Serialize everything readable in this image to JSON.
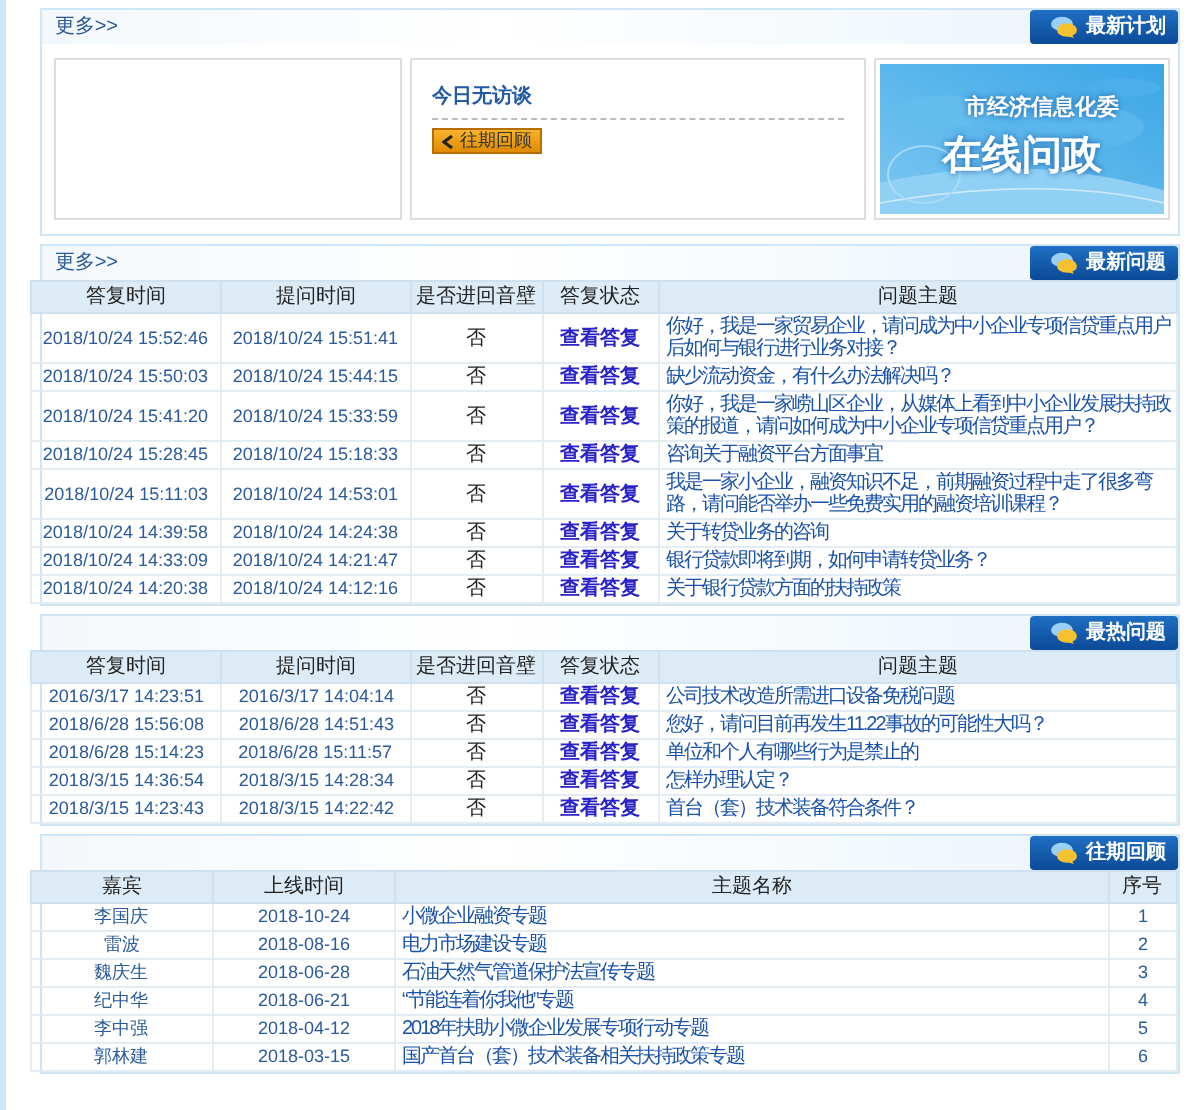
{
  "plan": {
    "more": "更多>>",
    "title": "最新计划",
    "interview": {
      "status": "今日无访谈",
      "button": "往期回顾"
    },
    "banner": {
      "line1": "市经济信息化委",
      "line2": "在线问政"
    }
  },
  "latest": {
    "more": "更多>>",
    "title": "最新问题",
    "columns": [
      "答复时间",
      "提问时间",
      "是否进回音壁",
      "答复状态",
      "问题主题"
    ],
    "rows": [
      {
        "answered": "2018/10/24 15:52:46",
        "asked": "2018/10/24 15:51:41",
        "wall": "否",
        "status": "查看答复",
        "topic": "你好，我是一家贸易企业，请问成为中小企业专项信贷重点用户后如何与银行进行业务对接？"
      },
      {
        "answered": "2018/10/24 15:50:03",
        "asked": "2018/10/24 15:44:15",
        "wall": "否",
        "status": "查看答复",
        "topic": "缺少流动资金，有什么办法解决吗？"
      },
      {
        "answered": "2018/10/24 15:41:20",
        "asked": "2018/10/24 15:33:59",
        "wall": "否",
        "status": "查看答复",
        "topic": "你好，我是一家崂山区企业，从媒体上看到中小企业发展扶持政策的报道，请问如何成为中小企业专项信贷重点用户？"
      },
      {
        "answered": "2018/10/24 15:28:45",
        "asked": "2018/10/24 15:18:33",
        "wall": "否",
        "status": "查看答复",
        "topic": "咨询关于融资平台方面事宜"
      },
      {
        "answered": "2018/10/24 15:11:03",
        "asked": "2018/10/24 14:53:01",
        "wall": "否",
        "status": "查看答复",
        "topic": "我是一家小企业，融资知识不足，前期融资过程中走了很多弯路，请问能否举办一些免费实用的融资培训课程？"
      },
      {
        "answered": "2018/10/24 14:39:58",
        "asked": "2018/10/24 14:24:38",
        "wall": "否",
        "status": "查看答复",
        "topic": "关于转贷业务的咨询"
      },
      {
        "answered": "2018/10/24 14:33:09",
        "asked": "2018/10/24 14:21:47",
        "wall": "否",
        "status": "查看答复",
        "topic": "银行贷款即将到期，如何申请转贷业务？"
      },
      {
        "answered": "2018/10/24 14:20:38",
        "asked": "2018/10/24 14:12:16",
        "wall": "否",
        "status": "查看答复",
        "topic": "关于银行贷款方面的扶持政策"
      }
    ]
  },
  "hot": {
    "title": "最热问题",
    "columns": [
      "答复时间",
      "提问时间",
      "是否进回音壁",
      "答复状态",
      "问题主题"
    ],
    "rows": [
      {
        "answered": "2016/3/17 14:23:51",
        "asked": "2016/3/17 14:04:14",
        "wall": "否",
        "status": "查看答复",
        "topic": "公司技术改造所需进口设备免税问题"
      },
      {
        "answered": "2018/6/28 15:56:08",
        "asked": "2018/6/28 14:51:43",
        "wall": "否",
        "status": "查看答复",
        "topic": "您好，请问目前再发生11.22事故的可能性大吗？"
      },
      {
        "answered": "2018/6/28 15:14:23",
        "asked": "2018/6/28 15:11:57",
        "wall": "否",
        "status": "查看答复",
        "topic": "单位和个人有哪些行为是禁止的"
      },
      {
        "answered": "2018/3/15 14:36:54",
        "asked": "2018/3/15 14:28:34",
        "wall": "否",
        "status": "查看答复",
        "topic": "怎样办理认定？"
      },
      {
        "answered": "2018/3/15 14:23:43",
        "asked": "2018/3/15 14:22:42",
        "wall": "否",
        "status": "查看答复",
        "topic": "首台（套）技术装备符合条件？"
      }
    ]
  },
  "past": {
    "title": "往期回顾",
    "columns": [
      "嘉宾",
      "上线时间",
      "主题名称",
      "序号"
    ],
    "rows": [
      {
        "guest": "李国庆",
        "date": "2018-10-24",
        "topic": "小微企业融资专题",
        "no": "1"
      },
      {
        "guest": "雷波",
        "date": "2018-08-16",
        "topic": "电力市场建设专题",
        "no": "2"
      },
      {
        "guest": "魏庆生",
        "date": "2018-06-28",
        "topic": "石油天然气管道保护法宣传专题",
        "no": "3"
      },
      {
        "guest": "纪中华",
        "date": "2018-06-21",
        "topic": "“节能连着你我他”专题",
        "no": "4"
      },
      {
        "guest": "李中强",
        "date": "2018-04-12",
        "topic": "2018年扶助小微企业发展专项行动专题",
        "no": "5"
      },
      {
        "guest": "郭林建",
        "date": "2018-03-15",
        "topic": "国产首台（套）技术装备相关扶持政策专题",
        "no": "6"
      }
    ]
  }
}
